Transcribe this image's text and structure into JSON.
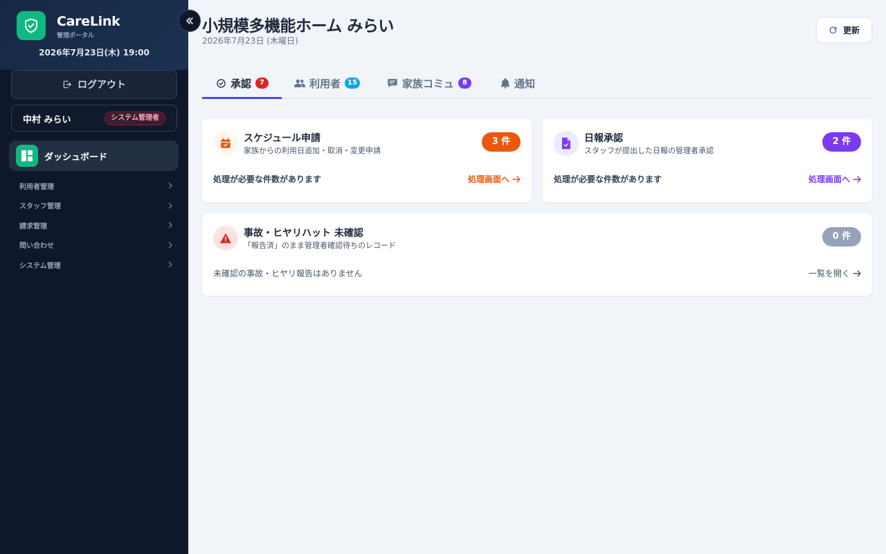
{
  "app": {
    "brand": "CareLink",
    "brand_sub": "管理ポータル",
    "datetime": "2026年7月23日(木) 19:00"
  },
  "sidebar": {
    "logout_label": "ログアウト",
    "user_name": "中村 みらい",
    "user_role": "システム管理者",
    "active_item": "ダッシュボード",
    "items": [
      {
        "label": "利用者管理"
      },
      {
        "label": "スタッフ管理"
      },
      {
        "label": "請求管理"
      },
      {
        "label": "問い合わせ"
      },
      {
        "label": "システム管理"
      }
    ]
  },
  "header": {
    "title": "小規模多機能ホーム みらい",
    "date": "2026年7月23日 (木曜日)",
    "refresh_label": "更新"
  },
  "tabs": [
    {
      "label": "承認",
      "badge": "7",
      "badge_color": "#dc2626",
      "active": true
    },
    {
      "label": "利用者",
      "badge": "15",
      "badge_color": "#0ea5e9",
      "active": false
    },
    {
      "label": "家族コミュ",
      "badge": "8",
      "badge_color": "#7c3aed",
      "active": false
    },
    {
      "label": "通知",
      "badge": "",
      "active": false
    }
  ],
  "cards": {
    "schedule": {
      "title": "スケジュール申請",
      "subtitle": "家族からの利用日追加・取消・変更申請",
      "count": "3 件",
      "message": "処理が必要な件数があります",
      "link": "処理画面へ",
      "color": "#ea580c"
    },
    "daily": {
      "title": "日報承認",
      "subtitle": "スタッフが提出した日報の管理者承認",
      "count": "2 件",
      "message": "処理が必要な件数があります",
      "link": "処理画面へ",
      "color": "#7c3aed"
    },
    "incident": {
      "title": "事故・ヒヤリハット 未確認",
      "subtitle": "「報告済」のまま管理者確認待ちのレコード",
      "count": "0 件",
      "message": "未確認の事故・ヒヤリ報告はありません",
      "link": "一覧を開く",
      "color": "#94a3b8"
    }
  }
}
